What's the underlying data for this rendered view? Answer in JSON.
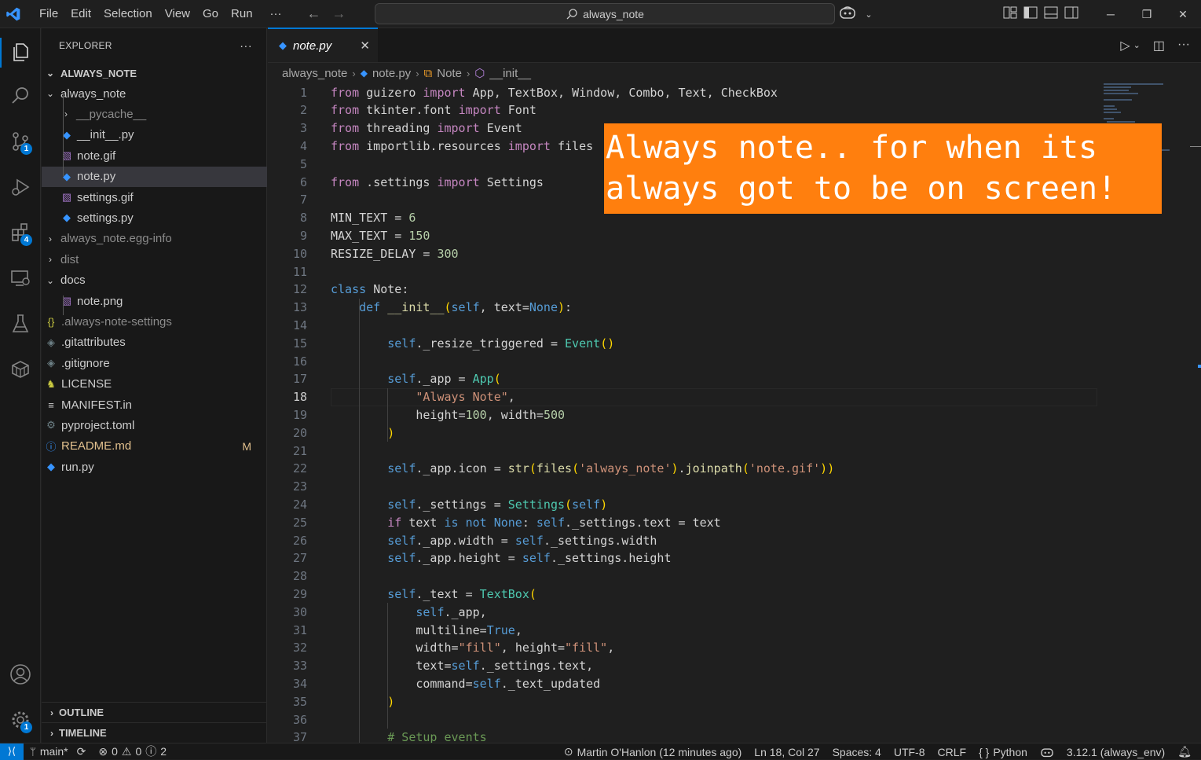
{
  "titlebar": {
    "menu": [
      "File",
      "Edit",
      "Selection",
      "View",
      "Go",
      "Run",
      "···"
    ],
    "search_text": "always_note"
  },
  "activity_bar": {
    "items": [
      {
        "icon": "files-icon",
        "badge": ""
      },
      {
        "icon": "search-icon",
        "badge": ""
      },
      {
        "icon": "source-control-icon",
        "badge": "1"
      },
      {
        "icon": "run-debug-icon",
        "badge": ""
      },
      {
        "icon": "extensions-icon",
        "badge": "4"
      },
      {
        "icon": "remote-explorer-icon",
        "badge": ""
      },
      {
        "icon": "testing-icon",
        "badge": ""
      },
      {
        "icon": "containers-icon",
        "badge": ""
      }
    ],
    "accounts_icon": "account-icon",
    "settings_badge": "1"
  },
  "sidebar": {
    "title": "EXPLORER",
    "more": "···",
    "root": "ALWAYS_NOTE",
    "tree": [
      {
        "label": "always_note",
        "chev": "⌄",
        "icon": "",
        "indent": 1,
        "dim": false
      },
      {
        "label": "__pycache__",
        "chev": "›",
        "icon": "",
        "indent": 2,
        "dim": true
      },
      {
        "label": "__init__.py",
        "chev": "",
        "icon": "py",
        "indent": 2,
        "dim": false
      },
      {
        "label": "note.gif",
        "chev": "",
        "icon": "img",
        "indent": 2,
        "dim": false
      },
      {
        "label": "note.py",
        "chev": "",
        "icon": "py",
        "indent": 2,
        "dim": false,
        "selected": true
      },
      {
        "label": "settings.gif",
        "chev": "",
        "icon": "img",
        "indent": 2,
        "dim": false
      },
      {
        "label": "settings.py",
        "chev": "",
        "icon": "py",
        "indent": 2,
        "dim": false
      },
      {
        "label": "always_note.egg-info",
        "chev": "›",
        "icon": "",
        "indent": 1,
        "dim": true
      },
      {
        "label": "dist",
        "chev": "›",
        "icon": "",
        "indent": 1,
        "dim": true
      },
      {
        "label": "docs",
        "chev": "⌄",
        "icon": "",
        "indent": 1,
        "dim": false
      },
      {
        "label": "note.png",
        "chev": "",
        "icon": "img",
        "indent": 2,
        "dim": false
      },
      {
        "label": ".always-note-settings",
        "chev": "",
        "icon": "json",
        "indent": 1,
        "dim": true
      },
      {
        "label": ".gitattributes",
        "chev": "",
        "icon": "git",
        "indent": 1,
        "dim": false
      },
      {
        "label": ".gitignore",
        "chev": "",
        "icon": "git",
        "indent": 1,
        "dim": false
      },
      {
        "label": "LICENSE",
        "chev": "",
        "icon": "license",
        "indent": 1,
        "dim": false
      },
      {
        "label": "MANIFEST.in",
        "chev": "",
        "icon": "lines",
        "indent": 1,
        "dim": false
      },
      {
        "label": "pyproject.toml",
        "chev": "",
        "icon": "gear",
        "indent": 1,
        "dim": false
      },
      {
        "label": "README.md",
        "chev": "",
        "icon": "info",
        "indent": 1,
        "dim": false,
        "modified": "M"
      },
      {
        "label": "run.py",
        "chev": "",
        "icon": "py",
        "indent": 1,
        "dim": false
      }
    ],
    "outline": "OUTLINE",
    "timeline": "TIMELINE"
  },
  "editor": {
    "tab": {
      "label": "note.py",
      "close": "✕"
    },
    "breadcrumb": [
      "always_note",
      "note.py",
      "Note",
      "__init__"
    ],
    "current_line": 18,
    "lines": [
      "from guizero import App, TextBox, Window, Combo, Text, CheckBox",
      "from tkinter.font import Font",
      "from threading import Event",
      "from importlib.resources import files",
      "",
      "from .settings import Settings",
      "",
      "MIN_TEXT = 6",
      "MAX_TEXT = 150",
      "RESIZE_DELAY = 300",
      "",
      "class Note:",
      "    def __init__(self, text=None):",
      "",
      "        self._resize_triggered = Event()",
      "",
      "        self._app = App(",
      "            \"Always Note\",",
      "            height=100, width=500",
      "        )",
      "",
      "        self._app.icon = str(files('always_note').joinpath('note.gif'))",
      "",
      "        self._settings = Settings(self)",
      "        if text is not None: self._settings.text = text",
      "        self._app.width = self._settings.width",
      "        self._app.height = self._settings.height",
      "",
      "        self._text = TextBox(",
      "            self._app,",
      "            multiline=True,",
      "            width=\"fill\", height=\"fill\",",
      "            text=self._settings.text,",
      "            command=self._text_updated",
      "        )",
      "",
      "        # Setup events"
    ]
  },
  "banner": {
    "line1": "Always note.. for when its",
    "line2": "always got to be on screen!",
    "color": "#ff7f0e"
  },
  "statusbar": {
    "branch": "main*",
    "errors": "0",
    "warnings": "0",
    "info": "2",
    "blame": "Martin O'Hanlon (12 minutes ago)",
    "position": "Ln 18, Col 27",
    "spaces": "Spaces: 4",
    "encoding": "UTF-8",
    "eol": "CRLF",
    "language": "Python",
    "interpreter": "3.12.1 (always_env)"
  }
}
